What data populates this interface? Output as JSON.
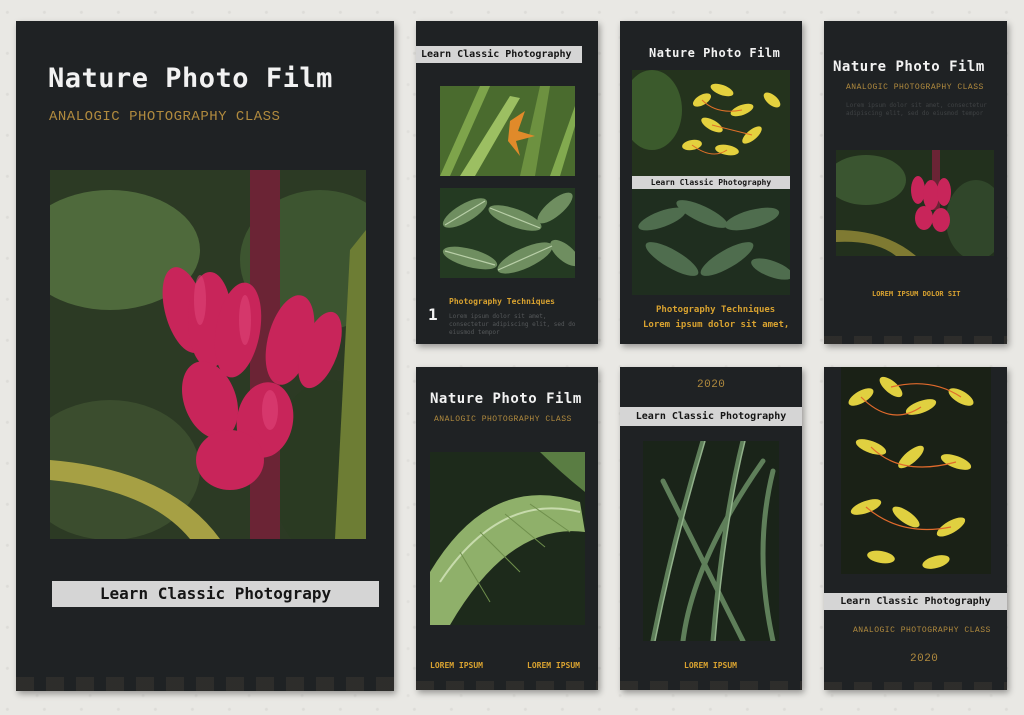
{
  "brand_colors": {
    "card": "#1f2224",
    "gold": "#d8a230",
    "label_bg": "#d5d5d5",
    "text": "#f2f2f2"
  },
  "card1": {
    "title": "Nature Photo Film",
    "subtitle": "ANALOGIC PHOTOGRAPHY CLASS",
    "label": "Learn Classic Photograpy"
  },
  "card2": {
    "label": "Learn Classic Photography",
    "page_number": "1",
    "heading": "Photography Techniques",
    "lorem": "Lorem ipsum dolor sit amet, consectetur adipiscing elit, sed do eiusmod tempor"
  },
  "card3": {
    "title": "Nature Photo Film",
    "label": "Learn Classic Photography",
    "heading": "Photography Techniques",
    "lorem": "Lorem ipsum dolor sit amet,"
  },
  "card4": {
    "title": "Nature Photo Film",
    "subtitle": "ANALOGIC PHOTOGRAPHY CLASS",
    "lorem": "Lorem ipsum dolor sit amet, consectetur adipiscing elit, sed do eiusmod tempor",
    "caption": "LOREM IPSUM DOLOR SIT"
  },
  "card5": {
    "title": "Nature Photo Film",
    "subtitle": "ANALOGIC PHOTOGRAPHY CLASS",
    "footer_left": "LOREM IPSUM",
    "footer_right": "LOREM IPSUM"
  },
  "card6": {
    "year": "2020",
    "label": "Learn Classic Photography",
    "footer": "LOREM IPSUM"
  },
  "card7": {
    "label": "Learn Classic Photography",
    "subtitle": "ANALOGIC PHOTOGRAPHY CLASS",
    "year": "2020"
  }
}
